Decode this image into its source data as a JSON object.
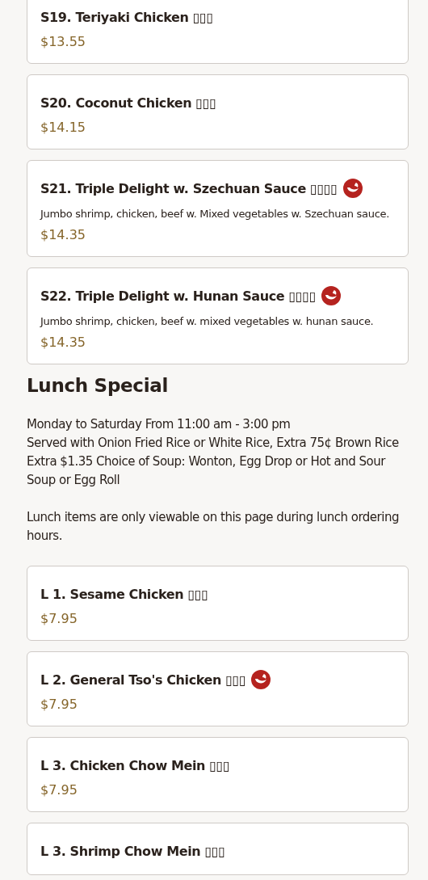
{
  "sections": [
    {
      "items": [
        {
          "title": "S19. Teriyaki Chicken ▯▯▯",
          "spicy": false,
          "price": "$13.55"
        },
        {
          "title": "S20. Coconut Chicken ▯▯▯",
          "spicy": false,
          "price": "$14.15"
        },
        {
          "title": "S21. Triple Delight w. Szechuan Sauce ▯▯▯▯",
          "spicy": true,
          "description": "Jumbo shrimp, chicken, beef w. Mixed vegetables w. Szechuan sauce.",
          "price": "$14.35"
        },
        {
          "title": "S22. Triple Delight w. Hunan Sauce ▯▯▯▯",
          "spicy": true,
          "description": "Jumbo shrimp, chicken, beef w. mixed vegetables w. hunan sauce.",
          "price": "$14.35"
        }
      ]
    },
    {
      "heading": "Lunch Special",
      "notes": [
        "Monday to Saturday From 11:00 am - 3:00 pm",
        "Served with Onion Fried Rice or White Rice, Extra 75¢ Brown Rice",
        "Extra $1.35 Choice of Soup: Wonton, Egg Drop or Hot and Sour Soup or Egg Roll"
      ],
      "notice": "Lunch items are only viewable on this page during lunch ordering hours.",
      "items": [
        {
          "title": "L 1. Sesame Chicken ▯▯▯",
          "spicy": false,
          "price": "$7.95"
        },
        {
          "title": "L 2. General Tso's Chicken ▯▯▯",
          "spicy": true,
          "price": "$7.95"
        },
        {
          "title": "L 3. Chicken Chow Mein ▯▯▯",
          "spicy": false,
          "price": "$7.95"
        },
        {
          "title": "L 3. Shrimp Chow Mein ▯▯▯",
          "spicy": false
        }
      ]
    }
  ]
}
